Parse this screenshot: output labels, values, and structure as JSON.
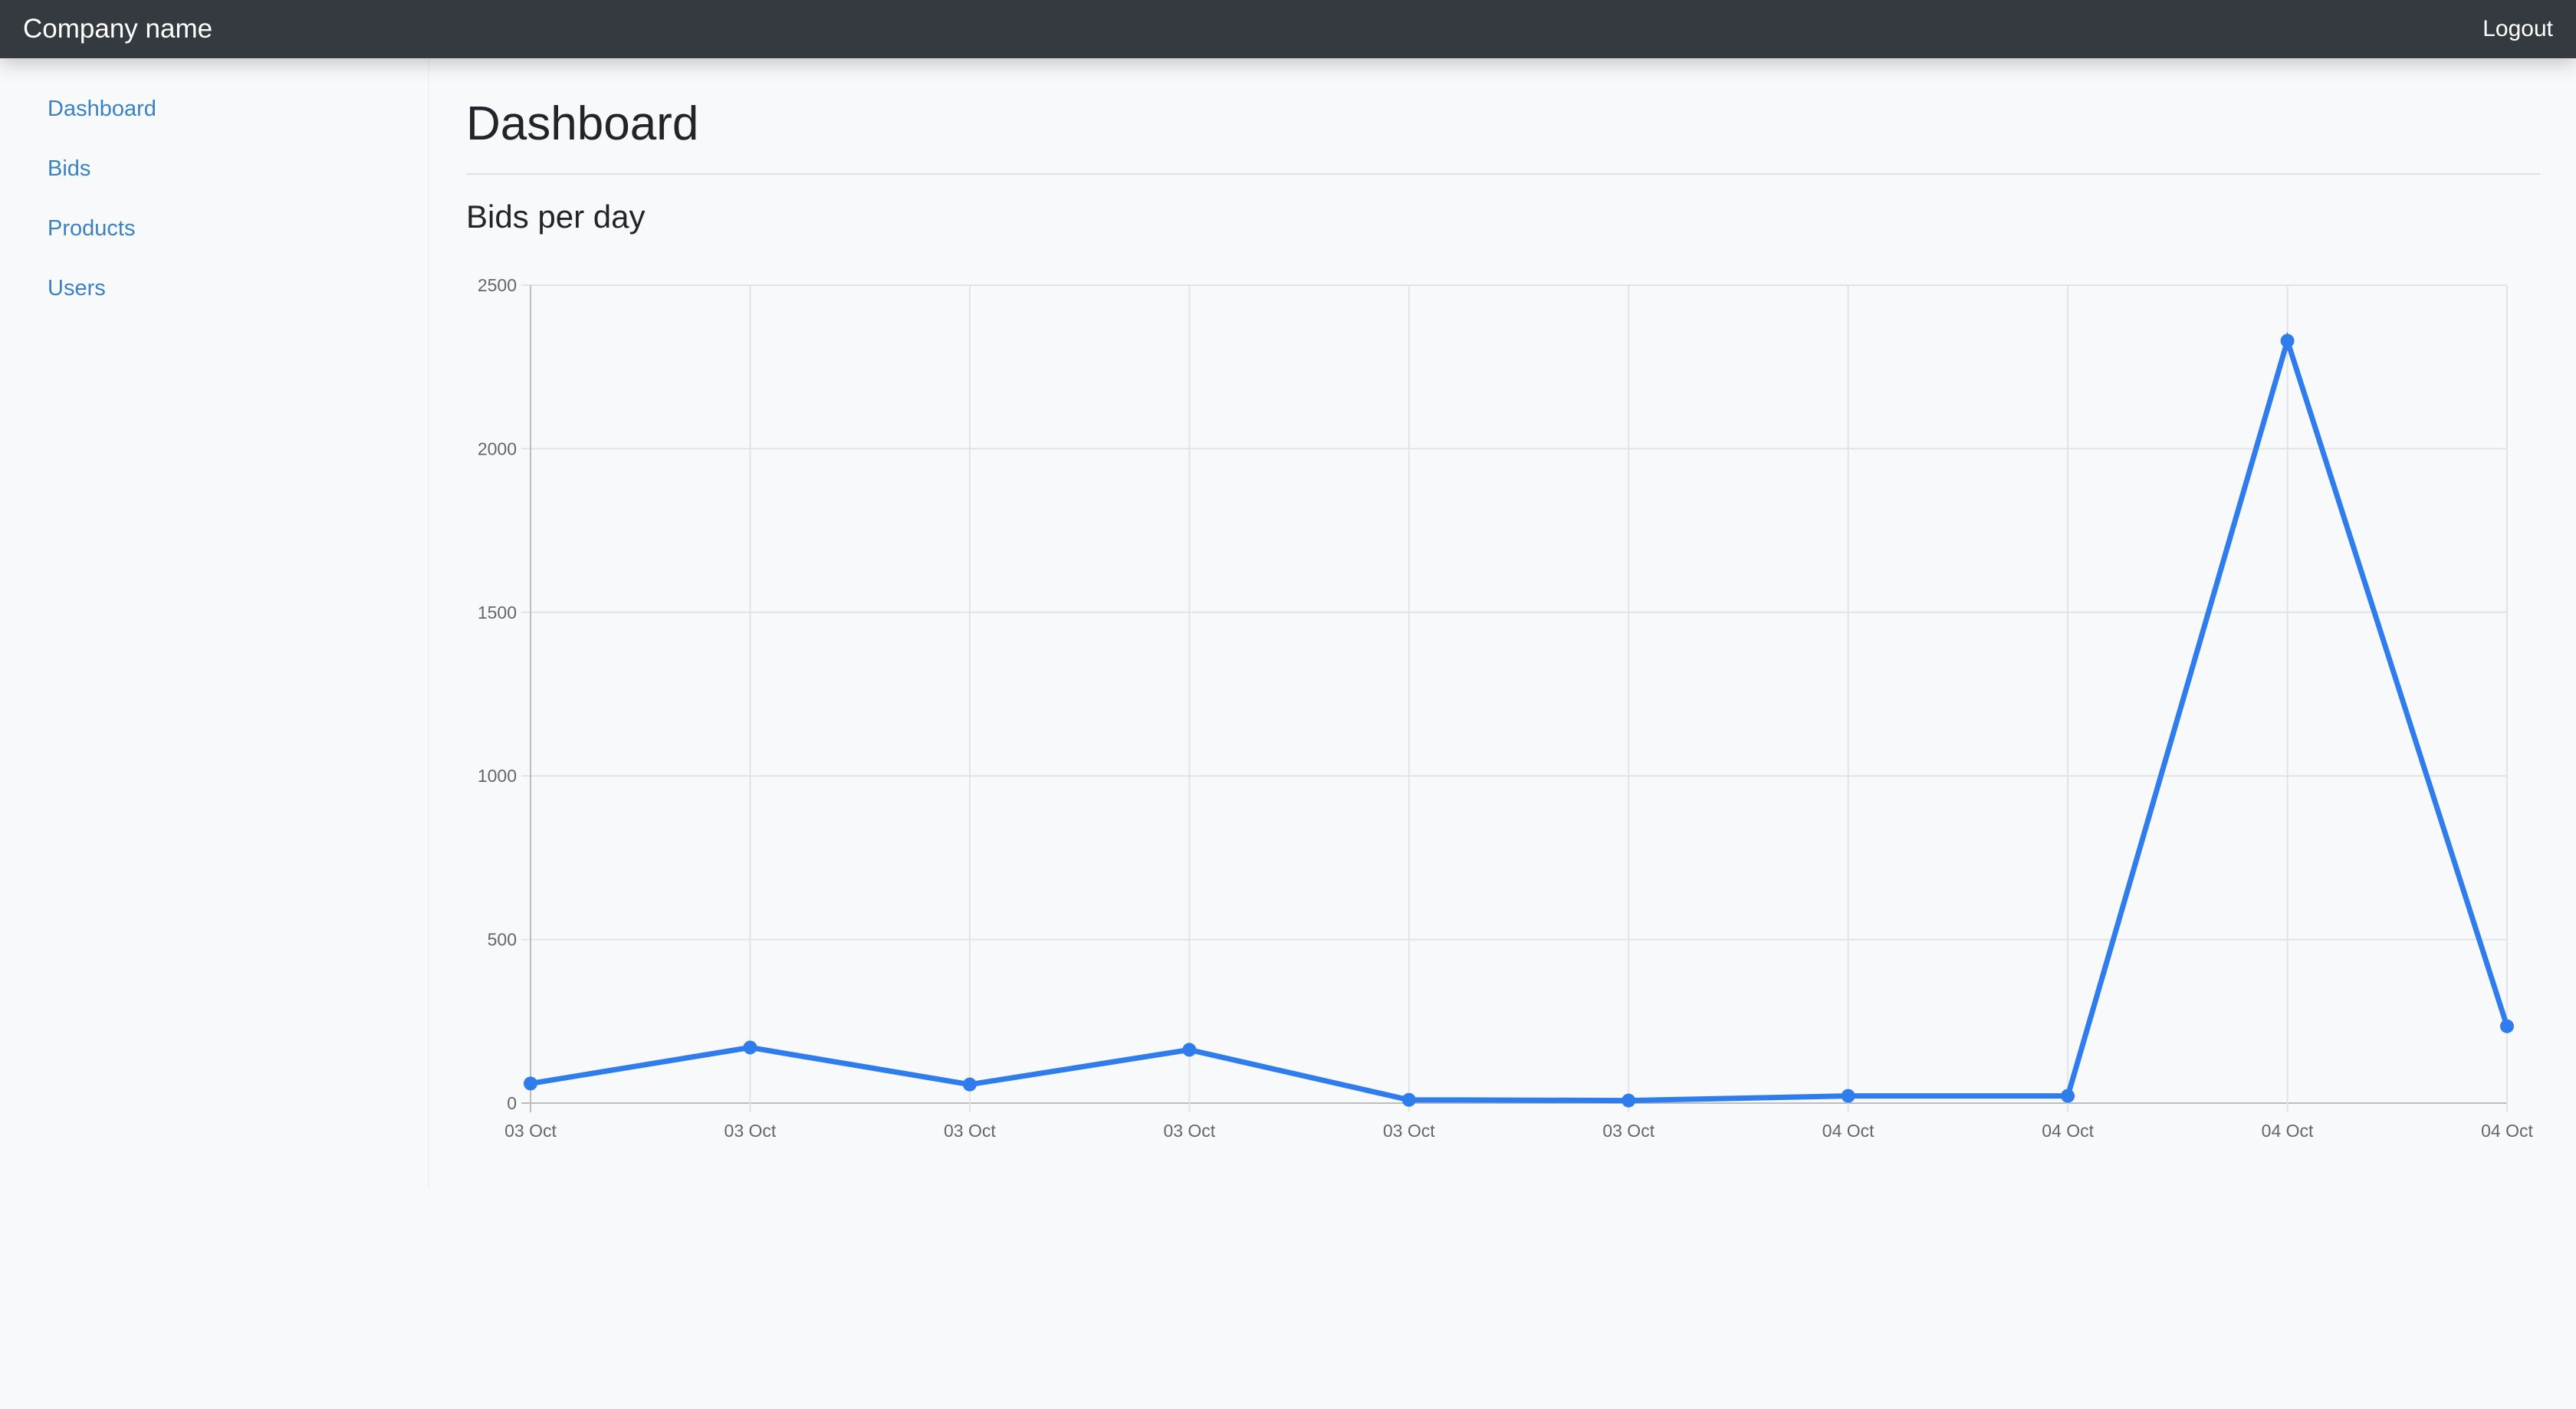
{
  "header": {
    "brand": "Company name",
    "logout_label": "Logout"
  },
  "sidebar": {
    "items": [
      {
        "label": "Dashboard"
      },
      {
        "label": "Bids"
      },
      {
        "label": "Products"
      },
      {
        "label": "Users"
      }
    ]
  },
  "main": {
    "title": "Dashboard",
    "section_title": "Bids per day"
  },
  "colors": {
    "topbar": "#343a40",
    "link": "#3b82c4",
    "series": "#2f7ded",
    "grid": "#e3e3e3"
  },
  "chart_data": {
    "type": "line",
    "title": "Bids per day",
    "xlabel": "",
    "ylabel": "",
    "categories": [
      "03 Oct",
      "03 Oct",
      "03 Oct",
      "03 Oct",
      "03 Oct",
      "03 Oct",
      "04 Oct",
      "04 Oct",
      "04 Oct",
      "04 Oct"
    ],
    "series": [
      {
        "values": [
          60,
          170,
          57,
          163,
          10,
          8,
          22,
          22,
          2330,
          235
        ]
      }
    ],
    "ylim": [
      0,
      2500
    ],
    "yticks": [
      0,
      500,
      1000,
      1500,
      2000,
      2500
    ],
    "grid": true
  }
}
